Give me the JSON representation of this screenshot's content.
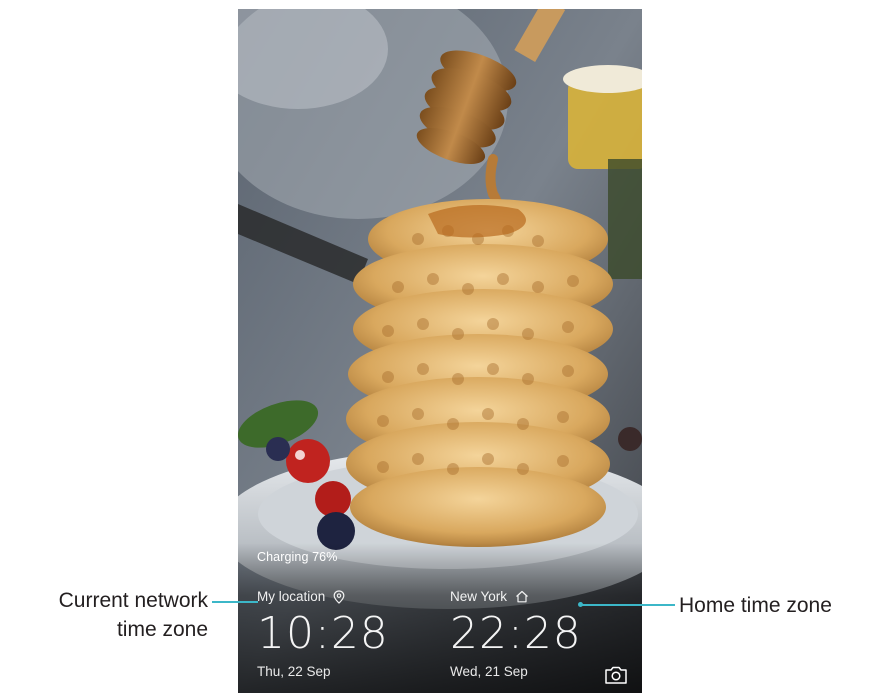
{
  "lock_screen": {
    "charging_text": "Charging 76%",
    "local_clock": {
      "label": "My location",
      "time": "10:28",
      "date": "Thu, 22 Sep"
    },
    "home_clock": {
      "label": "New York",
      "time": "22:28",
      "date": "Wed, 21 Sep"
    },
    "wallpaper_subject": "waffle stack with honey dipper"
  },
  "callouts": {
    "current_network_line1": "Current network",
    "current_network_line2": "time zone",
    "home_time_zone": "Home time zone"
  },
  "icons": {
    "location": "location-pin-icon",
    "home": "home-icon",
    "camera": "camera-icon"
  },
  "colors": {
    "leader_line": "#3cb7c8",
    "callout_text": "#231f20",
    "clock_text": "#ffffff"
  }
}
